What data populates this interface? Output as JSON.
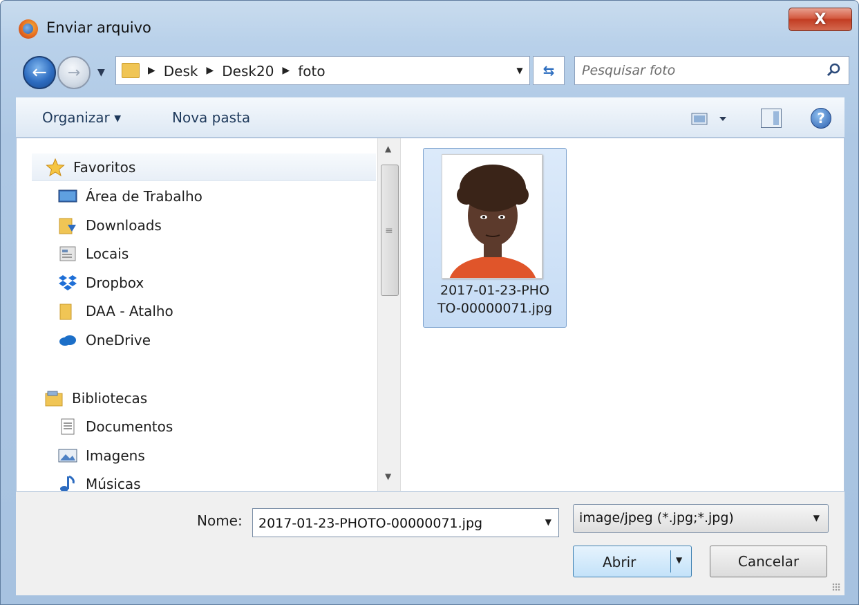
{
  "window": {
    "title": "Enviar arquivo",
    "close_symbol": "X"
  },
  "nav": {
    "back_symbol": "←",
    "forward_symbol": "→",
    "breadcrumbs": [
      "Desk",
      "Desk20",
      "foto"
    ],
    "search_placeholder": "Pesquisar foto"
  },
  "toolbar": {
    "organize_label": "Organizar ▾",
    "new_folder_label": "Nova pasta",
    "help_symbol": "?"
  },
  "sidebar": {
    "favorites_header": "Favoritos",
    "favorites": [
      "Área de Trabalho",
      "Downloads",
      "Locais",
      "Dropbox",
      "DAA - Atalho",
      "OneDrive"
    ],
    "libraries_header": "Bibliotecas",
    "libraries": [
      "Documentos",
      "Imagens",
      "Músicas"
    ]
  },
  "files": [
    {
      "name": "2017-01-23-PHOTO-00000071.jpg",
      "label_line1": "2017-01-23-PHO",
      "label_line2": "TO-00000071.jpg",
      "selected": true
    }
  ],
  "footer": {
    "name_label": "Nome:",
    "name_value": "2017-01-23-PHOTO-00000071.jpg",
    "filetype": "image/jpeg (*.jpg;*.jpg)",
    "open_label": "Abrir",
    "cancel_label": "Cancelar"
  },
  "colors": {
    "accent": "#2d6cc0",
    "selection": "#c6dcf5",
    "close": "#c23c22"
  }
}
